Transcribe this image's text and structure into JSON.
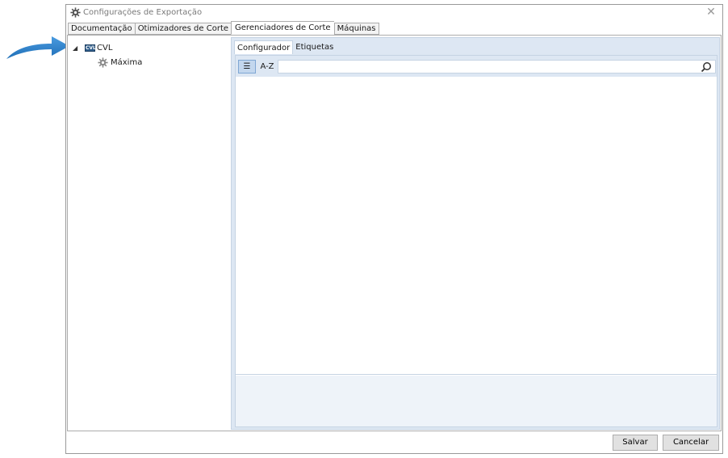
{
  "window": {
    "title": "Configurações de Exportação",
    "close_glyph": "✕"
  },
  "tabs": [
    {
      "label": "Documentação"
    },
    {
      "label": "Otimizadores de Corte"
    },
    {
      "label": "Gerenciadores de Corte",
      "active": true
    },
    {
      "label": "Máquinas"
    }
  ],
  "tree": {
    "root": {
      "label": "CVL",
      "badge": "CVL",
      "expanded": true,
      "expander_glyph": "◢"
    },
    "children": [
      {
        "label": "Máxima",
        "icon": "gear-icon"
      }
    ]
  },
  "subtabs": [
    {
      "label": "Configurador",
      "active": true
    },
    {
      "label": "Etiquetas"
    }
  ],
  "toolbar": {
    "categorized_glyph": "☰",
    "alphabetical_label": "A-Z",
    "search_value": ""
  },
  "footer": {
    "save_label": "Salvar",
    "cancel_label": "Cancelar"
  },
  "colors": {
    "arrow": "#2b7bc6",
    "panel": "#dde7f3",
    "accent": "#7fa7d4"
  }
}
